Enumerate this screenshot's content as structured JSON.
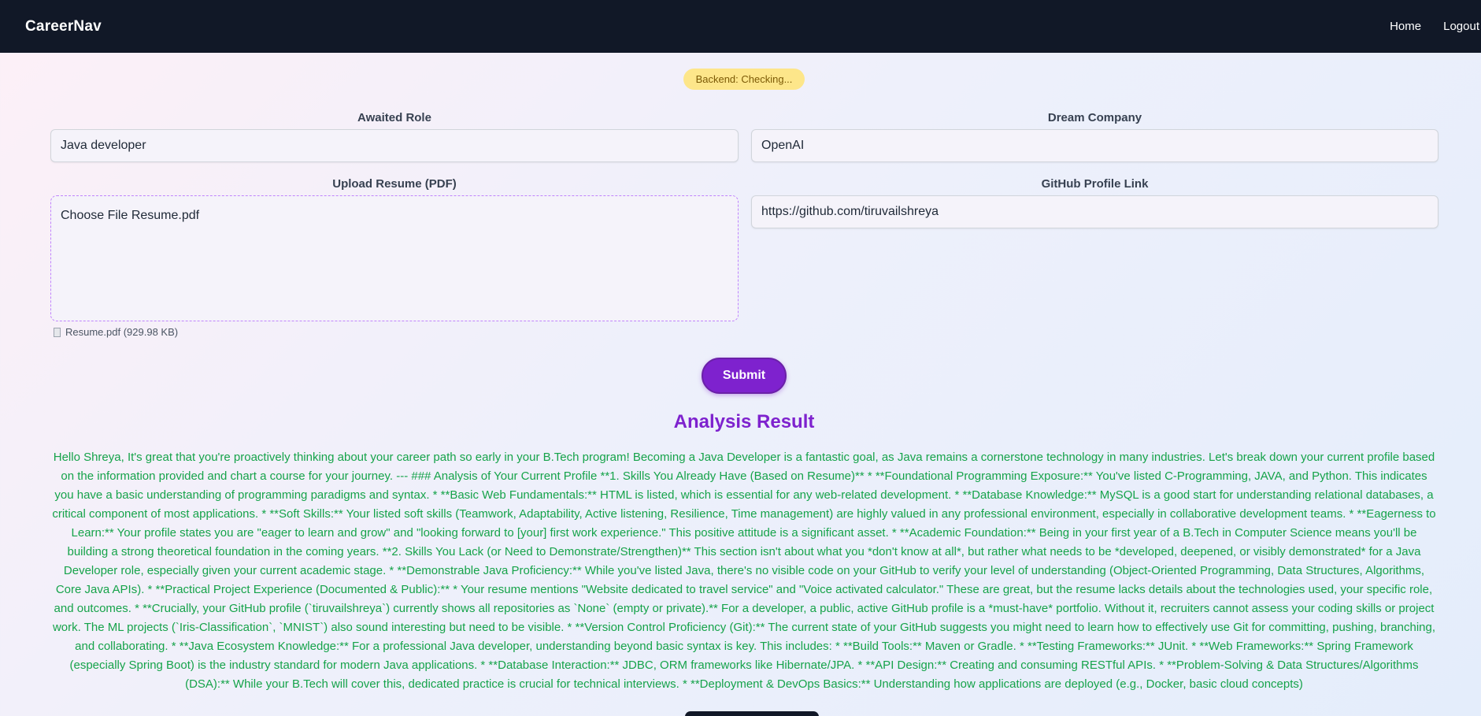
{
  "navbar": {
    "brand": "CareerNav",
    "links": [
      "Home",
      "Logout"
    ]
  },
  "status": {
    "badge": "Backend: Checking...",
    "badge_color": "#fde68a"
  },
  "form": {
    "role_label": "Awaited Role",
    "role_value": "Java developer",
    "company_label": "Dream Company",
    "company_value": "OpenAI",
    "resume_label": "Upload Resume (PDF)",
    "resume_input_text": "Choose File Resume.pdf",
    "resume_file_info": "Resume.pdf (929.98 KB)",
    "github_label": "GitHub Profile Link",
    "github_value": "https://github.com/tiruvailshreya",
    "submit_label": "Submit"
  },
  "result": {
    "title": "Analysis Result",
    "text": "Hello Shreya, It's great that you're proactively thinking about your career path so early in your B.Tech program! Becoming a Java Developer is a fantastic goal, as Java remains a cornerstone technology in many industries. Let's break down your current profile based on the information provided and chart a course for your journey. --- ### Analysis of Your Current Profile **1. Skills You Already Have (Based on Resume)** * **Foundational Programming Exposure:** You've listed C-Programming, JAVA, and Python. This indicates you have a basic understanding of programming paradigms and syntax. * **Basic Web Fundamentals:** HTML is listed, which is essential for any web-related development. * **Database Knowledge:** MySQL is a good start for understanding relational databases, a critical component of most applications. * **Soft Skills:** Your listed soft skills (Teamwork, Adaptability, Active listening, Resilience, Time management) are highly valued in any professional environment, especially in collaborative development teams. * **Eagerness to Learn:** Your profile states you are \"eager to learn and grow\" and \"looking forward to [your] first work experience.\" This positive attitude is a significant asset. * **Academic Foundation:** Being in your first year of a B.Tech in Computer Science means you'll be building a strong theoretical foundation in the coming years. **2. Skills You Lack (or Need to Demonstrate/Strengthen)** This section isn't about what you *don't know at all*, but rather what needs to be *developed, deepened, or visibly demonstrated* for a Java Developer role, especially given your current academic stage. * **Demonstrable Java Proficiency:** While you've listed Java, there's no visible code on your GitHub to verify your level of understanding (Object-Oriented Programming, Data Structures, Algorithms, Core Java APIs). * **Practical Project Experience (Documented & Public):** * Your resume mentions \"Website dedicated to travel service\" and \"Voice activated calculator.\" These are great, but the resume lacks details about the technologies used, your specific role, and outcomes. * **Crucially, your GitHub profile (`tiruvailshreya`) currently shows all repositories as `None` (empty or private).** For a developer, a public, active GitHub profile is a *must-have* portfolio. Without it, recruiters cannot assess your coding skills or project work. The ML projects (`Iris-Classification`, `MNIST`) also sound interesting but need to be visible. * **Version Control Proficiency (Git):** The current state of your GitHub suggests you might need to learn how to effectively use Git for committing, pushing, branching, and collaborating. * **Java Ecosystem Knowledge:** For a professional Java developer, understanding beyond basic syntax is key. This includes: * **Build Tools:** Maven or Gradle. * **Testing Frameworks:** JUnit. * **Web Frameworks:** Spring Framework (especially Spring Boot) is the industry standard for modern Java applications. * **Database Interaction:** JDBC, ORM frameworks like Hibernate/JPA. * **API Design:** Creating and consuming RESTful APIs. * **Problem-Solving & Data Structures/Algorithms (DSA):** While your B.Tech will cover this, dedicated practice is crucial for technical interviews. * **Deployment & DevOps Basics:** Understanding how applications are deployed (e.g., Docker, basic cloud concepts)"
  }
}
